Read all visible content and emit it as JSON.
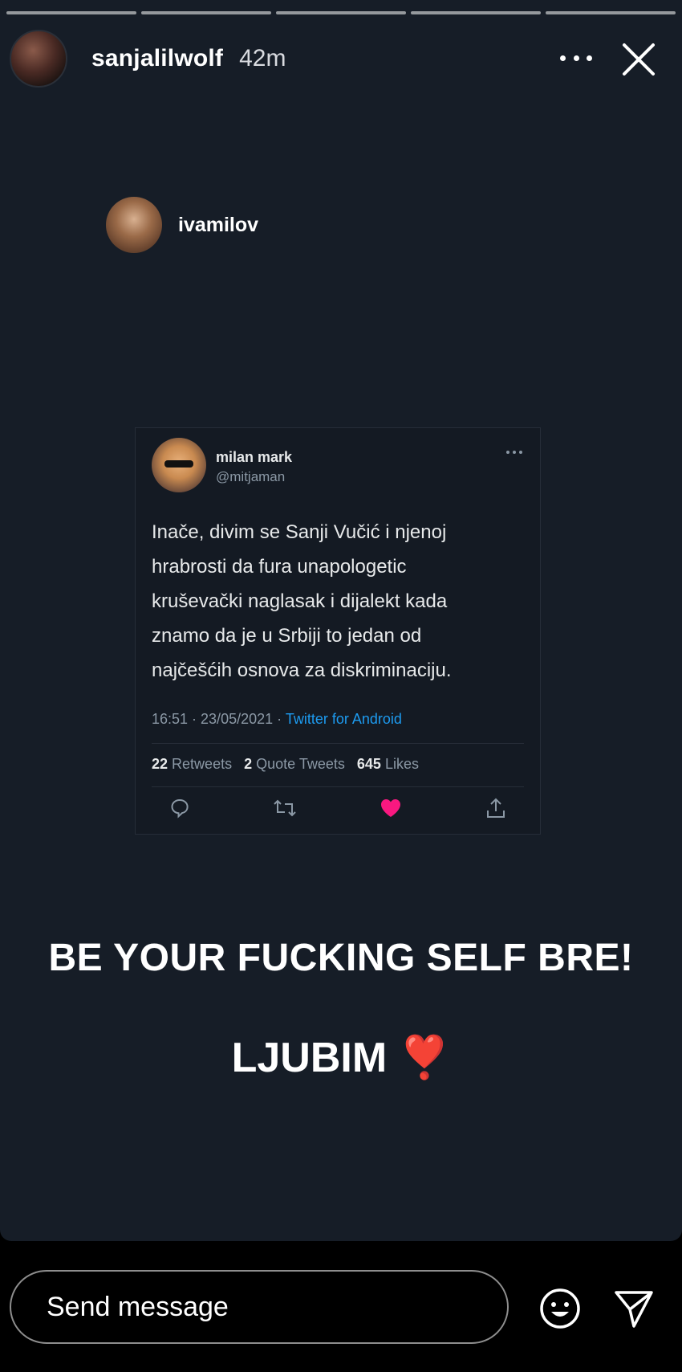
{
  "story": {
    "author": "sanjalilwolf",
    "time": "42m",
    "progress_segments": 5,
    "reshare_username": "ivamilov"
  },
  "tweet": {
    "name": "milan mark",
    "handle": "@mitjaman",
    "text_lines": [
      "Inače, divim se Sanji Vučić i njenoj",
      "hrabrosti da fura unapologetic",
      "kruševački naglasak i dijalekt kada",
      "znamo da je u Srbiji to jedan od",
      "najčešćih osnova za diskriminaciju."
    ],
    "timestamp": "16:51 · 23/05/2021 · ",
    "source": "Twitter for Android",
    "retweets_count": "22",
    "retweets_label": "Retweets",
    "quotes_count": "2",
    "quotes_label": "Quote Tweets",
    "likes_count": "645",
    "likes_label": "Likes"
  },
  "caption": {
    "line1": "BE YOUR FUCKING SELF BRE!",
    "line2": "LJUBIM",
    "line2_emoji": "❣️"
  },
  "composer": {
    "placeholder": "Send message"
  },
  "icons": {
    "more": "more-horizontal-icon",
    "close": "close-icon",
    "reply": "reply-icon",
    "retweet": "retweet-icon",
    "like": "heart-icon",
    "share": "share-icon",
    "emoji": "smiley-icon",
    "send": "send-icon"
  },
  "colors": {
    "story_background": "#161d27",
    "like_active": "#f91880",
    "link": "#1d9bf0",
    "heart_emoji": "#e0243a"
  }
}
